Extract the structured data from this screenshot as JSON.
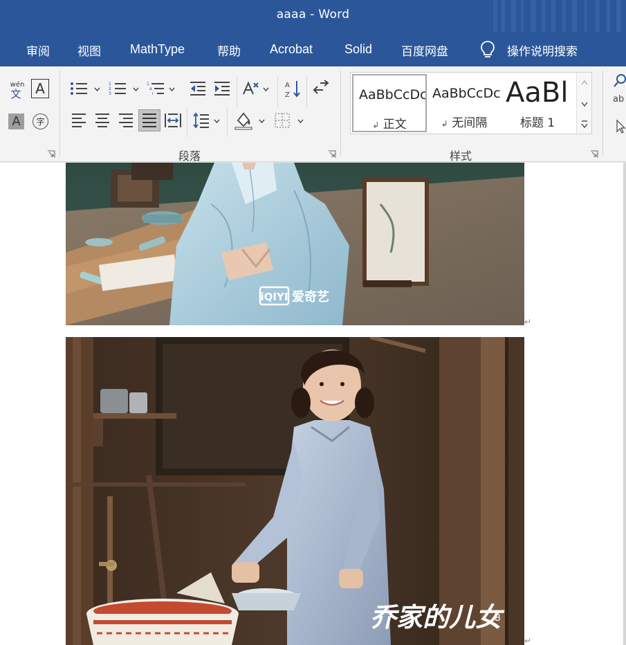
{
  "window": {
    "title": "aaaa  -  Word"
  },
  "tabs": [
    {
      "label": "审阅",
      "latin": false
    },
    {
      "label": "视图",
      "latin": false
    },
    {
      "label": "MathType",
      "latin": true
    },
    {
      "label": "帮助",
      "latin": false
    },
    {
      "label": "Acrobat",
      "latin": true
    },
    {
      "label": "Solid",
      "latin": true
    },
    {
      "label": "百度网盘",
      "latin": false
    }
  ],
  "tell_me": {
    "label": "操作说明搜索",
    "icon": "lightbulb-icon"
  },
  "ribbon": {
    "font_group": {
      "phonetic_guide": {
        "pinyin": "wén",
        "char": "文"
      },
      "char_border_glyph": "A",
      "char_shading_glyph": "A",
      "enclose_char_glyph": "字"
    },
    "paragraph_group": {
      "label": "段落"
    },
    "styles_group": {
      "label": "样式",
      "items": [
        {
          "sample": "AaBbCcDc",
          "name": "正文",
          "selected": true,
          "mark": "↲"
        },
        {
          "sample": "AaBbCcDc",
          "name": "无间隔",
          "selected": false,
          "mark": "↲"
        },
        {
          "sample": "AaBl",
          "name": "标题 1",
          "selected": false,
          "mark": ""
        }
      ]
    },
    "editing_group": {
      "replace_glyph": "ab"
    }
  },
  "document": {
    "images": [
      {
        "watermark": "爱奇艺",
        "watermark_logo": "iQIYI",
        "scene": "hanfu-hands-heart"
      },
      {
        "watermark": "乔家的儿女",
        "watermark_small": "B",
        "scene": "girl-washing-basin"
      }
    ],
    "paragraph_mark": "↵"
  },
  "colors": {
    "title_bar": "#2b579a",
    "ribbon_bg": "#f3f3f3",
    "document_bg": "#ffffff"
  }
}
